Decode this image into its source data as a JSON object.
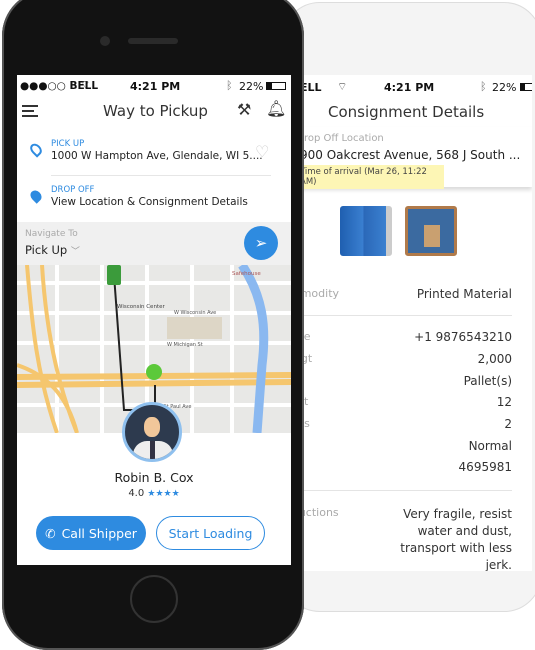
{
  "back_phone": {
    "status": {
      "carrier": "ELL",
      "time": "4:21 PM",
      "battery": "22%"
    },
    "title": "Consignment Details",
    "dropoff_label": "rop Off Location",
    "dropoff_address": "900 Oakcrest Avenue, 568 J South ...",
    "arrival": "Time of arrival (Mar 26, 11:22 AM)",
    "rows": [
      {
        "label": "mmodity",
        "value": "Printed Material"
      },
      {
        "label": "one",
        "value": "+1 9876543210"
      },
      {
        "label": "Wgt",
        "value": "2,000"
      },
      {
        "label": "ts",
        "value": "Pallet(s)"
      },
      {
        "label": "unt",
        "value": "12"
      },
      {
        "label": "lets",
        "value": "2"
      },
      {
        "label": "np",
        "value": "Normal"
      },
      {
        "label": "#",
        "value": "4695981"
      },
      {
        "label": "tructions",
        "value": "Very fragile, resist water and dust, transport with less jerk."
      }
    ]
  },
  "front_phone": {
    "status": {
      "carrier": "●●●○○ BELL",
      "time": "4:21 PM",
      "battery": "22%"
    },
    "title": "Way to Pickup",
    "pickup": {
      "label": "PICK UP",
      "address": "1000 W Hampton Ave, Glendale, WI 5...."
    },
    "dropoff": {
      "label": "DROP OFF",
      "text": "View Location & Consignment Details"
    },
    "navigate": {
      "label": "Navigate To",
      "value": "Pick Up"
    },
    "map_labels": {
      "a": "Wisconsin Center",
      "b": "W Wisconsin Ave",
      "c": "W Michigan St",
      "d": "W St Paul Ave",
      "e": "Safehouse"
    },
    "driver": {
      "name": "Robin B. Cox",
      "rating": "4.0",
      "stars": "★★★★"
    },
    "buttons": {
      "call": "Call Shipper",
      "start": "Start Loading"
    }
  },
  "colors": {
    "accent": "#2e8be0",
    "highlight": "#fdf6b5",
    "highway": "#f5c66e",
    "water": "#8ab8f0",
    "route_dot": "#5cc93a"
  }
}
